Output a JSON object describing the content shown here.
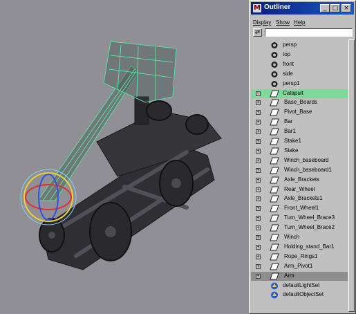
{
  "outliner": {
    "title": "Outliner",
    "window_buttons": [
      "minimize",
      "maximize",
      "close"
    ],
    "menu": [
      "Display",
      "Show",
      "Help"
    ],
    "items": [
      {
        "label": "persp",
        "icon": "camera-icon",
        "indent": 0,
        "expander": "",
        "state": ""
      },
      {
        "label": "top",
        "icon": "camera-icon",
        "indent": 0,
        "expander": "",
        "state": ""
      },
      {
        "label": "front",
        "icon": "camera-icon",
        "indent": 0,
        "expander": "",
        "state": ""
      },
      {
        "label": "side",
        "icon": "camera-icon",
        "indent": 0,
        "expander": "",
        "state": ""
      },
      {
        "label": "persp1",
        "icon": "camera-icon",
        "indent": 0,
        "expander": "",
        "state": ""
      },
      {
        "label": "Catapult",
        "icon": "transform-icon",
        "indent": 0,
        "expander": "−",
        "state": "selected"
      },
      {
        "label": "Base_Boards",
        "icon": "transform-icon",
        "indent": 1,
        "expander": "+",
        "state": ""
      },
      {
        "label": "Pivot_Base",
        "icon": "transform-icon",
        "indent": 1,
        "expander": "+",
        "state": ""
      },
      {
        "label": "Bar",
        "icon": "transform-icon",
        "indent": 1,
        "expander": "+",
        "state": ""
      },
      {
        "label": "Bar1",
        "icon": "transform-icon",
        "indent": 1,
        "expander": "+",
        "state": ""
      },
      {
        "label": "Stake1",
        "icon": "transform-icon",
        "indent": 1,
        "expander": "+",
        "state": ""
      },
      {
        "label": "Stake",
        "icon": "transform-icon",
        "indent": 1,
        "expander": "+",
        "state": ""
      },
      {
        "label": "Winch_baseboard",
        "icon": "transform-icon",
        "indent": 1,
        "expander": "+",
        "state": ""
      },
      {
        "label": "Winch_baseboard1",
        "icon": "transform-icon",
        "indent": 1,
        "expander": "+",
        "state": ""
      },
      {
        "label": "Axle_Brackets",
        "icon": "transform-icon",
        "indent": 1,
        "expander": "+",
        "state": ""
      },
      {
        "label": "Rear_Wheel",
        "icon": "transform-icon",
        "indent": 1,
        "expander": "+",
        "state": ""
      },
      {
        "label": "Axle_Brackets1",
        "icon": "transform-icon",
        "indent": 1,
        "expander": "+",
        "state": ""
      },
      {
        "label": "Front_Wheel1",
        "icon": "transform-icon",
        "indent": 1,
        "expander": "+",
        "state": ""
      },
      {
        "label": "Turn_Wheel_Brace3",
        "icon": "transform-icon",
        "indent": 1,
        "expander": "+",
        "state": ""
      },
      {
        "label": "Turn_Wheel_Brace2",
        "icon": "transform-icon",
        "indent": 1,
        "expander": "+",
        "state": ""
      },
      {
        "label": "Winch",
        "icon": "transform-icon",
        "indent": 1,
        "expander": "+",
        "state": ""
      },
      {
        "label": "Holding_stand_Bar1",
        "icon": "transform-icon",
        "indent": 1,
        "expander": "+",
        "state": ""
      },
      {
        "label": "Rope_Rings1",
        "icon": "transform-icon",
        "indent": 1,
        "expander": "+",
        "state": ""
      },
      {
        "label": "Arm_Pivot1",
        "icon": "transform-icon",
        "indent": 1,
        "expander": "+",
        "state": ""
      },
      {
        "label": "Arm",
        "icon": "transform-icon",
        "indent": 1,
        "expander": "+",
        "state": "highlight"
      },
      {
        "label": "defaultLightSet",
        "icon": "set-icon",
        "indent": 0,
        "expander": "",
        "state": ""
      },
      {
        "label": "defaultObjectSet",
        "icon": "set-icon",
        "indent": 0,
        "expander": "",
        "state": ""
      }
    ]
  },
  "viewport": {
    "background": "#8f8f95",
    "wireframe_color": "#59e0a0",
    "manipulator_colors": [
      "#e03030",
      "#e8d23a",
      "#3050e0"
    ]
  }
}
